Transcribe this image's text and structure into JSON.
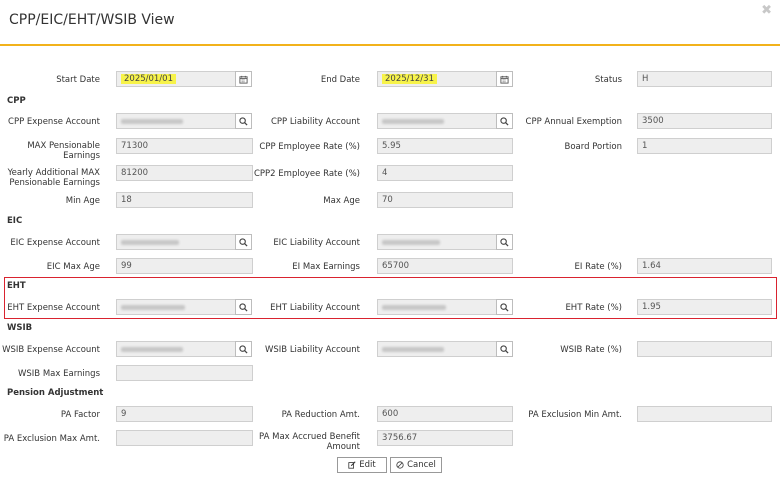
{
  "window": {
    "title": "CPP/EIC/EHT/WSIB View",
    "close_glyph": "✖"
  },
  "dates": {
    "start_label": "Start Date",
    "start_value": "2025/01/01",
    "end_label": "End Date",
    "end_value": "2025/12/31",
    "status_label": "Status",
    "status_value": "H"
  },
  "cpp": {
    "section": "CPP",
    "expense_account_label": "CPP Expense Account",
    "liability_account_label": "CPP Liability Account",
    "annual_exemption_label": "CPP Annual Exemption",
    "annual_exemption": "3500",
    "max_pensionable_label_1": "MAX Pensionable",
    "max_pensionable_label_2": "Earnings",
    "max_pensionable": "71300",
    "employee_rate_label": "CPP Employee Rate (%)",
    "employee_rate": "5.95",
    "board_portion_label": "Board Portion",
    "board_portion": "1",
    "yearly_additional_label_1": "Yearly Additional MAX",
    "yearly_additional_label_2": "Pensionable Earnings",
    "yearly_additional": "81200",
    "cpp2_rate_label": "CPP2 Employee Rate (%)",
    "cpp2_rate": "4",
    "min_age_label": "Min Age",
    "min_age": "18",
    "max_age_label": "Max Age",
    "max_age": "70"
  },
  "eic": {
    "section": "EIC",
    "expense_account_label": "EIC Expense Account",
    "liability_account_label": "EIC Liability Account",
    "max_age_label": "EIC Max Age",
    "max_age": "99",
    "ei_max_earnings_label": "EI Max Earnings",
    "ei_max_earnings": "65700",
    "ei_rate_label": "EI Rate (%)",
    "ei_rate": "1.64"
  },
  "eht": {
    "section": "EHT",
    "expense_account_label": "EHT Expense Account",
    "liability_account_label": "EHT Liability Account",
    "rate_label": "EHT Rate (%)",
    "rate": "1.95"
  },
  "wsib": {
    "section": "WSIB",
    "expense_account_label": "WSIB Expense Account",
    "liability_account_label": "WSIB Liability Account",
    "rate_label": "WSIB Rate (%)",
    "rate": "",
    "max_earnings_label": "WSIB Max Earnings",
    "max_earnings": ""
  },
  "pension": {
    "section": "Pension Adjustment",
    "pa_factor_label": "PA Factor",
    "pa_factor": "9",
    "pa_reduction_label": "PA Reduction Amt.",
    "pa_reduction": "600",
    "pa_exclusion_min_label": "PA Exclusion Min Amt.",
    "pa_exclusion_min": "",
    "pa_exclusion_max_label": "PA Exclusion Max Amt.",
    "pa_exclusion_max": "",
    "pa_max_accrued_label_1": "PA Max Accrued Benefit",
    "pa_max_accrued_label_2": "Amount",
    "pa_max_accrued": "3756.67"
  },
  "buttons": {
    "edit": "Edit",
    "cancel": "Cancel"
  },
  "icons": {
    "calendar": "calendar-icon",
    "search": "search-icon",
    "edit": "edit-icon",
    "cancel": "cancel-icon"
  },
  "colors": {
    "accent": "#f2b21b",
    "highlight": "#f7f34a",
    "red_box": "#d9232f"
  }
}
